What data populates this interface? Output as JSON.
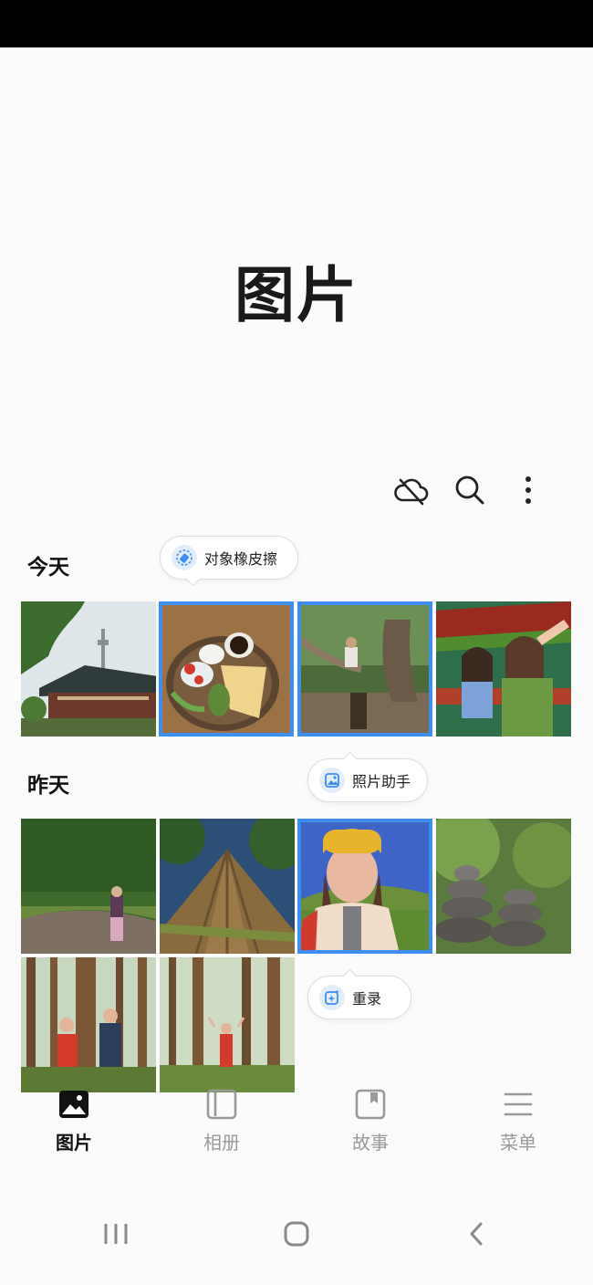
{
  "header": {
    "title": "图片"
  },
  "toolbar": {
    "icons": [
      "cloud-off-icon",
      "search-icon",
      "more-vert-icon"
    ]
  },
  "sections": {
    "today": {
      "label": "今天"
    },
    "yesterday": {
      "label": "昨天"
    }
  },
  "suggestion_chips": {
    "object_eraser": {
      "label": "对象橡皮擦",
      "icon": "eraser-icon"
    },
    "photo_assistant": {
      "label": "照片助手",
      "icon": "photo-assistant-icon"
    },
    "remaster": {
      "label": "重录",
      "icon": "remaster-icon"
    }
  },
  "bottom_nav": {
    "pictures": {
      "label": "图片",
      "icon": "pictures-icon",
      "active": true
    },
    "albums": {
      "label": "相册",
      "icon": "albums-icon",
      "active": false
    },
    "stories": {
      "label": "故事",
      "icon": "stories-icon",
      "active": false
    },
    "menu": {
      "label": "菜单",
      "icon": "menu-icon",
      "active": false
    }
  },
  "system_nav": {
    "buttons": [
      "recents-icon",
      "home-icon",
      "back-icon"
    ]
  },
  "colors": {
    "accent": "#3d8ef0",
    "status_bar": "#000000",
    "background": "#fbfbfb"
  }
}
